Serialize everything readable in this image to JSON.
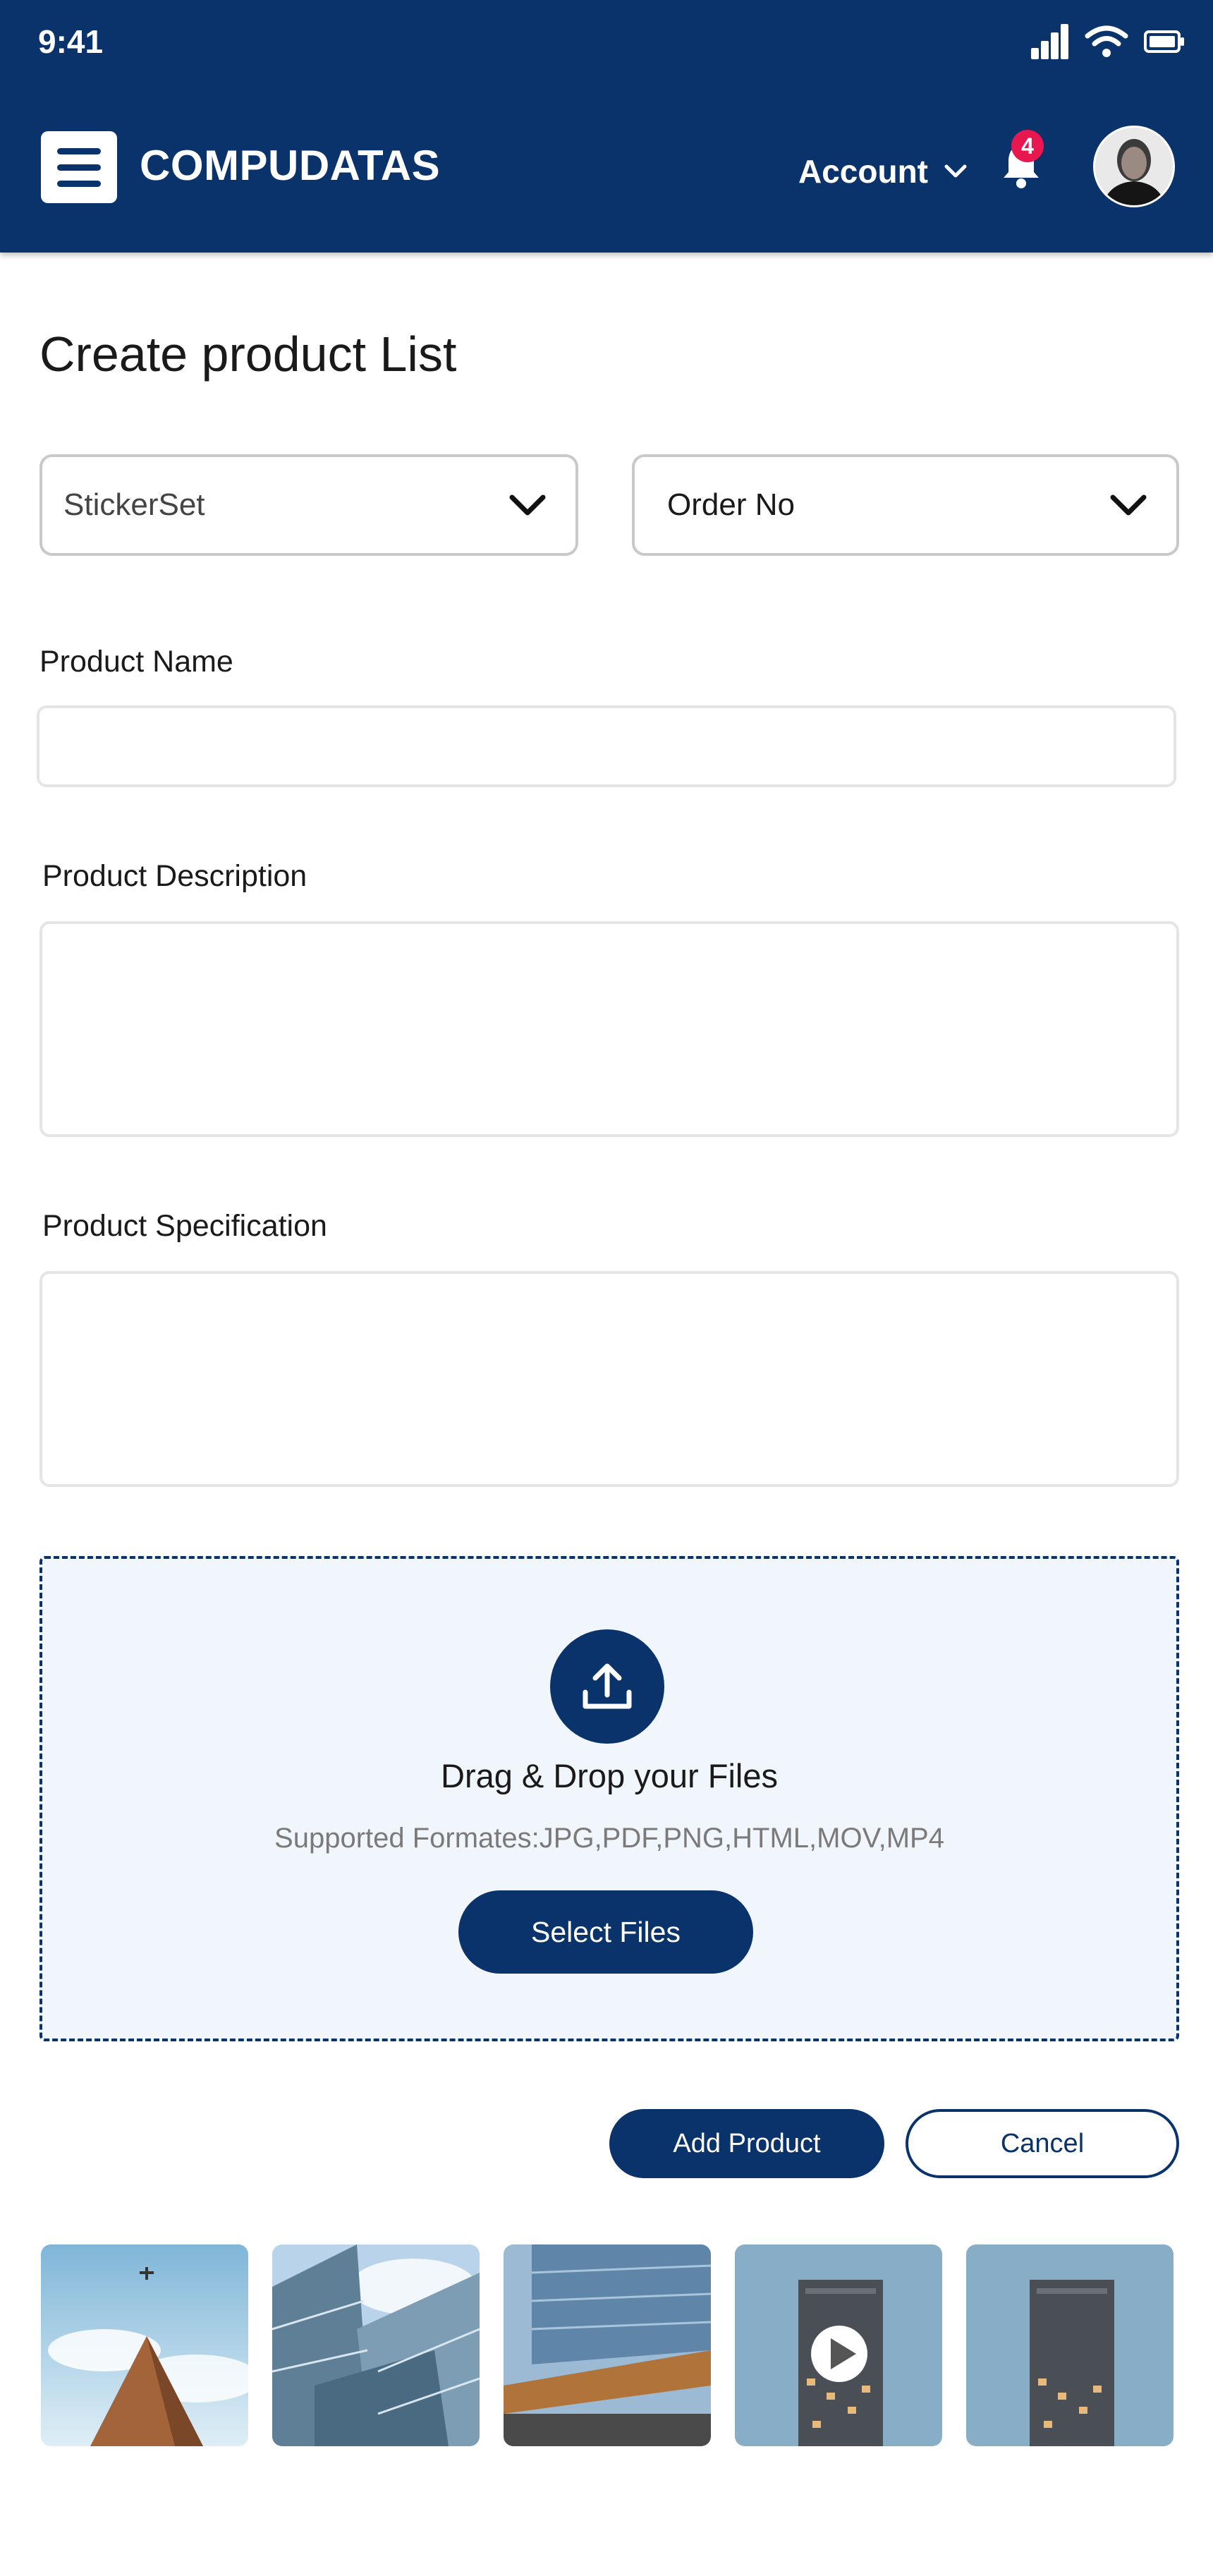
{
  "status_bar": {
    "time": "9:41"
  },
  "header": {
    "brand": "COMPUDATAS",
    "account_label": "Account",
    "notification_count": "4"
  },
  "page": {
    "title": "Create product List"
  },
  "filters": {
    "category_select": {
      "value": "StickerSet"
    },
    "order_select": {
      "value": "Order No"
    }
  },
  "form": {
    "product_name_label": "Product Name",
    "product_name_value": "",
    "product_description_label": "Product Description",
    "product_description_value": "",
    "product_specification_label": "Product Specification",
    "product_specification_value": ""
  },
  "upload": {
    "title": "Drag & Drop your Files",
    "formats": "Supported Formates:JPG,PDF,PNG,HTML,MOV,MP4",
    "button_label": "Select Files"
  },
  "actions": {
    "add_label": "Add Product",
    "cancel_label": "Cancel"
  },
  "gallery": [
    {
      "name": "tower-with-plane-image"
    },
    {
      "name": "glass-building-image"
    },
    {
      "name": "modern-building-image"
    },
    {
      "name": "tower-video",
      "video": true
    },
    {
      "name": "tower-image"
    }
  ],
  "colors": {
    "primary": "#0b336b",
    "badge": "#e8174f",
    "dropzone_bg": "#f1f6fc"
  }
}
